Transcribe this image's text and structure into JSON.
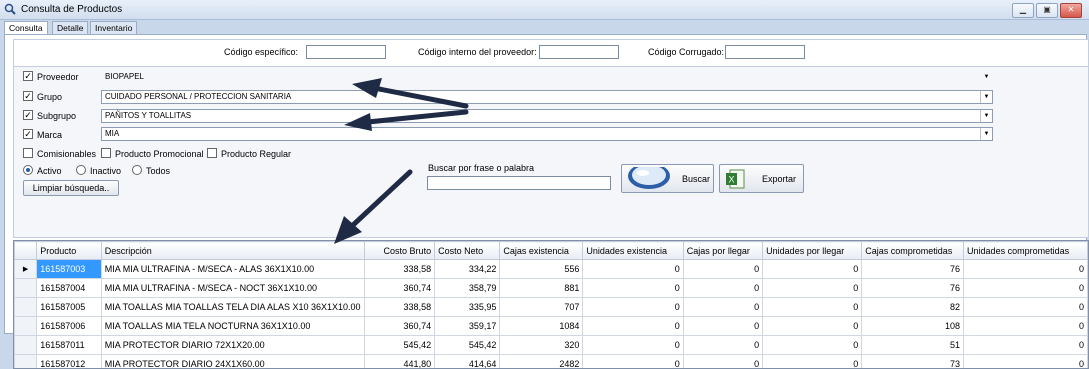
{
  "window": {
    "title": "Consulta de Productos"
  },
  "tabs": [
    "Consulta",
    "Detalle",
    "Inventario"
  ],
  "codes": {
    "codigo_especifico": "Código específico:",
    "codigo_interno": "Código interno del proveedor:",
    "codigo_corrugado": "Código Corrugado:"
  },
  "filters": {
    "proveedor": {
      "label": "Proveedor",
      "value": "BIOPAPEL"
    },
    "grupo": {
      "label": "Grupo",
      "value": "CUIDADO PERSONAL / PROTECCION SANITARIA"
    },
    "subgrupo": {
      "label": "Subgrupo",
      "value": "PAÑITOS Y TOALLITAS"
    },
    "marca": {
      "label": "Marca",
      "value": "MIA"
    },
    "comisionables": "Comisionables",
    "promocional": "Producto Promocional",
    "regular": "Producto Regular",
    "activo": "Activo",
    "inactivo": "Inactivo",
    "todos": "Todos",
    "limpiar": "Limpiar búsqueda..",
    "buscar_frase": "Buscar por frase o palabra",
    "buscar": "Buscar",
    "exportar": "Exportar"
  },
  "grid": {
    "columns": [
      "Producto",
      "Descripción",
      "Costo Bruto",
      "Costo Neto",
      "Cajas existencia",
      "Unidades existencia",
      "Cajas por llegar",
      "Unidades por llegar",
      "Cajas comprometidas",
      "Unidades comprometidas"
    ],
    "rows": [
      [
        "161587003",
        "MIA MIA ULTRAFINA - M/SECA - ALAS 36X1X10.00",
        "338,58",
        "334,22",
        "556",
        "0",
        "0",
        "0",
        "76",
        "0"
      ],
      [
        "161587004",
        "MIA MIA ULTRAFINA - M/SECA - NOCT 36X1X10.00",
        "360,74",
        "358,79",
        "881",
        "0",
        "0",
        "0",
        "76",
        "0"
      ],
      [
        "161587005",
        "MIA TOALLAS MIA TOALLAS TELA DIA ALAS X10 36X1X10.00",
        "338,58",
        "335,95",
        "707",
        "0",
        "0",
        "0",
        "82",
        "0"
      ],
      [
        "161587006",
        "MIA TOALLAS MIA TELA NOCTURNA 36X1X10.00",
        "360,74",
        "359,17",
        "1084",
        "0",
        "0",
        "0",
        "108",
        "0"
      ],
      [
        "161587011",
        "MIA PROTECTOR DIARIO 72X1X20.00",
        "545,42",
        "545,42",
        "320",
        "0",
        "0",
        "0",
        "51",
        "0"
      ],
      [
        "161587012",
        "MIA PROTECTOR DIARIO 24X1X60.00",
        "441,80",
        "414,64",
        "2482",
        "0",
        "0",
        "0",
        "73",
        "0"
      ]
    ]
  }
}
